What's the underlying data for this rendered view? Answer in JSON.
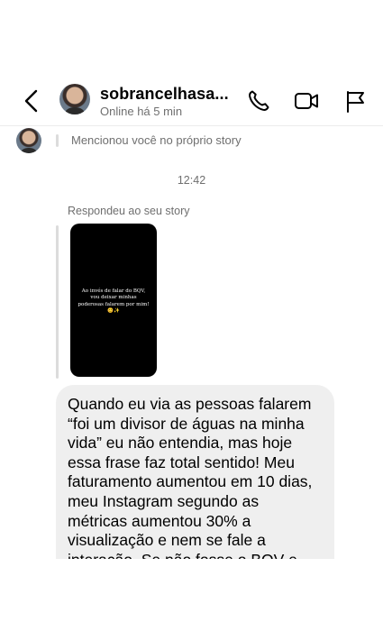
{
  "header": {
    "title": "sobrancelhasa...",
    "status": "Online há 5 min",
    "icons": [
      "back-chevron-icon",
      "phone-icon",
      "video-camera-icon",
      "flag-icon"
    ]
  },
  "thread": {
    "story_mention": "Mencionou você no próprio story",
    "timestamp": "12:42",
    "replied_label": "Respondeu ao seu story",
    "story_caption": "Ao invés de falar do BQV, vou deixar minhas poderosas falarem por mim! 😊✨",
    "message": "Quando eu via as pessoas falarem\n“foi um divisor de águas na minha\nvida” eu não entendia, mas hoje\nessa frase faz total sentido! Meu\nfaturamento aumentou em 10 dias,\nmeu Instagram segundo as\nmétricas aumentou 30% a\nvisualização e nem se fale a\ninteração. Se não fosse o BQV e"
  }
}
